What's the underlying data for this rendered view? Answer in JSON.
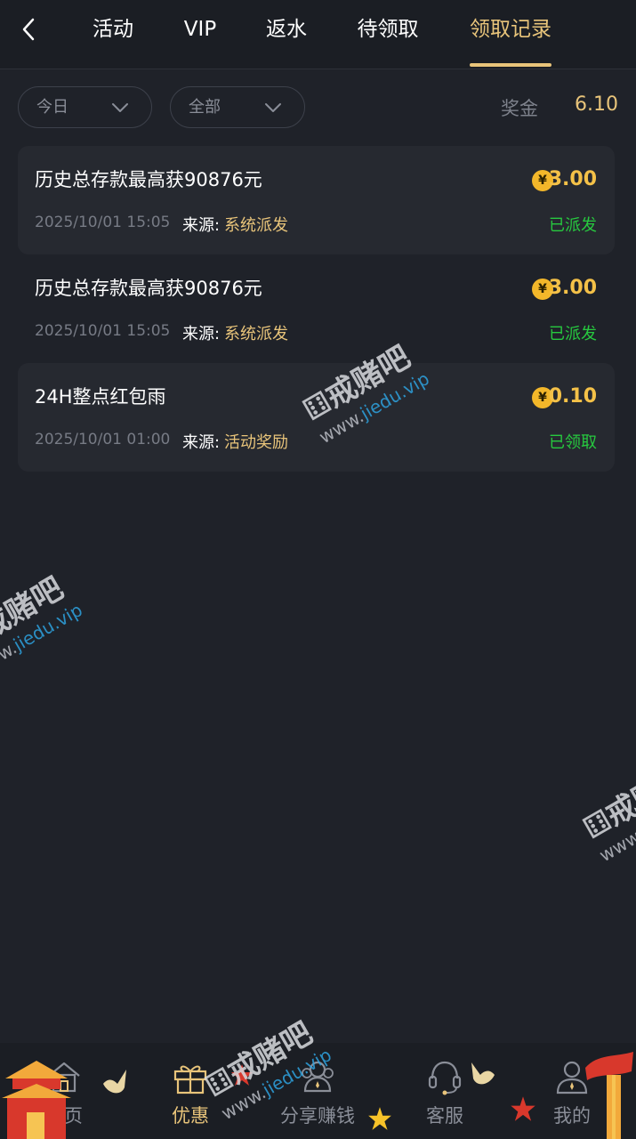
{
  "header": {
    "tabs": [
      {
        "label": "活动",
        "active": false
      },
      {
        "label": "VIP",
        "active": false
      },
      {
        "label": "返水",
        "active": false
      },
      {
        "label": "待领取",
        "active": false
      },
      {
        "label": "领取记录",
        "active": true
      }
    ]
  },
  "filters": {
    "date": {
      "value": "今日"
    },
    "type": {
      "value": "全部"
    }
  },
  "summary": {
    "bonus_label": "奖金",
    "bonus_value": "6.10"
  },
  "records": [
    {
      "title": "历史总存款最高获90876元",
      "time": "2025/10/01 15:05",
      "source_label": "来源:",
      "source": "系统派发",
      "currency_symbol": "¥",
      "amount": "3.00",
      "status": "已派发"
    },
    {
      "title": "历史总存款最高获90876元",
      "time": "2025/10/01 15:05",
      "source_label": "来源:",
      "source": "系统派发",
      "currency_symbol": "¥",
      "amount": "3.00",
      "status": "已派发"
    },
    {
      "title": "24H整点红包雨",
      "time": "2025/10/01 01:00",
      "source_label": "来源:",
      "source": "活动奖励",
      "currency_symbol": "¥",
      "amount": "0.10",
      "status": "已领取"
    }
  ],
  "watermark": {
    "brand": "戒赌吧",
    "www": "www.",
    "domain": "jiedu.vip"
  },
  "bottom_nav": [
    {
      "label": "首页",
      "icon": "home-icon",
      "active": false
    },
    {
      "label": "优惠",
      "icon": "gift-icon",
      "active": true
    },
    {
      "label": "分享赚钱",
      "icon": "share-earn-icon",
      "active": false
    },
    {
      "label": "客服",
      "icon": "headset-icon",
      "active": false
    },
    {
      "label": "我的",
      "icon": "user-icon",
      "active": false
    }
  ],
  "colors": {
    "background": "#1f2229",
    "accent_gold": "#e8c47a",
    "amount_gold": "#f4c148",
    "status_green": "#27c93f",
    "muted_text": "#777b85"
  }
}
